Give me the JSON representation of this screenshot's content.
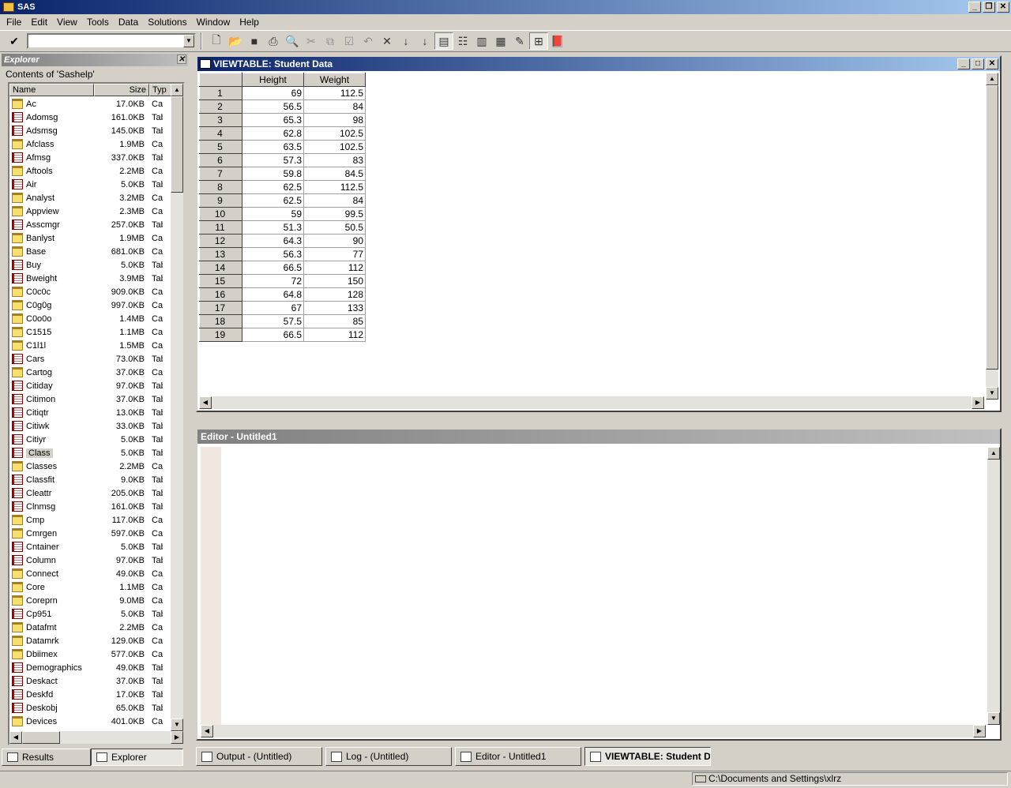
{
  "app": {
    "title": "SAS"
  },
  "menu": [
    "File",
    "Edit",
    "View",
    "Tools",
    "Data",
    "Solutions",
    "Window",
    "Help"
  ],
  "command_box": {
    "value": ""
  },
  "explorer": {
    "title": "Explorer",
    "contents_label": "Contents of 'Sashelp'",
    "columns": [
      "Name",
      "Size",
      "Typ"
    ],
    "items": [
      {
        "name": "Ac",
        "size": "17.0KB",
        "type": "Cata",
        "icon": "folder"
      },
      {
        "name": "Adomsg",
        "size": "161.0KB",
        "type": "Tabl",
        "icon": "table"
      },
      {
        "name": "Adsmsg",
        "size": "145.0KB",
        "type": "Tabl",
        "icon": "table"
      },
      {
        "name": "Afclass",
        "size": "1.9MB",
        "type": "Cata",
        "icon": "folder"
      },
      {
        "name": "Afmsg",
        "size": "337.0KB",
        "type": "Tabl",
        "icon": "table"
      },
      {
        "name": "Aftools",
        "size": "2.2MB",
        "type": "Cata",
        "icon": "folder"
      },
      {
        "name": "Air",
        "size": "5.0KB",
        "type": "Tabl",
        "icon": "table"
      },
      {
        "name": "Analyst",
        "size": "3.2MB",
        "type": "Cata",
        "icon": "folder"
      },
      {
        "name": "Appview",
        "size": "2.3MB",
        "type": "Cata",
        "icon": "folder"
      },
      {
        "name": "Asscmgr",
        "size": "257.0KB",
        "type": "Tabl",
        "icon": "table"
      },
      {
        "name": "Banlyst",
        "size": "1.9MB",
        "type": "Cata",
        "icon": "folder"
      },
      {
        "name": "Base",
        "size": "681.0KB",
        "type": "Cata",
        "icon": "folder"
      },
      {
        "name": "Buy",
        "size": "5.0KB",
        "type": "Tabl",
        "icon": "table"
      },
      {
        "name": "Bweight",
        "size": "3.9MB",
        "type": "Tabl",
        "icon": "table"
      },
      {
        "name": "C0c0c",
        "size": "909.0KB",
        "type": "Cata",
        "icon": "folder"
      },
      {
        "name": "C0g0g",
        "size": "997.0KB",
        "type": "Cata",
        "icon": "folder"
      },
      {
        "name": "C0o0o",
        "size": "1.4MB",
        "type": "Cata",
        "icon": "folder"
      },
      {
        "name": "C1515",
        "size": "1.1MB",
        "type": "Cata",
        "icon": "folder"
      },
      {
        "name": "C1l1l",
        "size": "1.5MB",
        "type": "Cata",
        "icon": "folder"
      },
      {
        "name": "Cars",
        "size": "73.0KB",
        "type": "Tabl",
        "icon": "table"
      },
      {
        "name": "Cartog",
        "size": "37.0KB",
        "type": "Cata",
        "icon": "folder"
      },
      {
        "name": "Citiday",
        "size": "97.0KB",
        "type": "Tabl",
        "icon": "table"
      },
      {
        "name": "Citimon",
        "size": "37.0KB",
        "type": "Tabl",
        "icon": "table"
      },
      {
        "name": "Citiqtr",
        "size": "13.0KB",
        "type": "Tabl",
        "icon": "table"
      },
      {
        "name": "Citiwk",
        "size": "33.0KB",
        "type": "Tabl",
        "icon": "table"
      },
      {
        "name": "Citiyr",
        "size": "5.0KB",
        "type": "Tabl",
        "icon": "table"
      },
      {
        "name": "Class",
        "size": "5.0KB",
        "type": "Tabl",
        "icon": "table",
        "selected": true
      },
      {
        "name": "Classes",
        "size": "2.2MB",
        "type": "Cata",
        "icon": "folder"
      },
      {
        "name": "Classfit",
        "size": "9.0KB",
        "type": "Tabl",
        "icon": "table"
      },
      {
        "name": "Cleattr",
        "size": "205.0KB",
        "type": "Tabl",
        "icon": "table"
      },
      {
        "name": "Clnmsg",
        "size": "161.0KB",
        "type": "Tabl",
        "icon": "table"
      },
      {
        "name": "Cmp",
        "size": "117.0KB",
        "type": "Cata",
        "icon": "folder"
      },
      {
        "name": "Cmrgen",
        "size": "597.0KB",
        "type": "Cata",
        "icon": "folder"
      },
      {
        "name": "Cntainer",
        "size": "5.0KB",
        "type": "Tabl",
        "icon": "table"
      },
      {
        "name": "Column",
        "size": "97.0KB",
        "type": "Tabl",
        "icon": "table"
      },
      {
        "name": "Connect",
        "size": "49.0KB",
        "type": "Cata",
        "icon": "folder"
      },
      {
        "name": "Core",
        "size": "1.1MB",
        "type": "Cata",
        "icon": "folder"
      },
      {
        "name": "Coreprn",
        "size": "9.0MB",
        "type": "Cata",
        "icon": "folder"
      },
      {
        "name": "Cp951",
        "size": "5.0KB",
        "type": "Tabl",
        "icon": "table"
      },
      {
        "name": "Datafmt",
        "size": "2.2MB",
        "type": "Cata",
        "icon": "folder"
      },
      {
        "name": "Datamrk",
        "size": "129.0KB",
        "type": "Cata",
        "icon": "folder"
      },
      {
        "name": "Dbiimex",
        "size": "577.0KB",
        "type": "Cata",
        "icon": "folder"
      },
      {
        "name": "Demographics",
        "size": "49.0KB",
        "type": "Tabl",
        "icon": "table"
      },
      {
        "name": "Deskact",
        "size": "37.0KB",
        "type": "Tabl",
        "icon": "table"
      },
      {
        "name": "Deskfd",
        "size": "17.0KB",
        "type": "Tabl",
        "icon": "table"
      },
      {
        "name": "Deskobj",
        "size": "65.0KB",
        "type": "Tabl",
        "icon": "table"
      },
      {
        "name": "Devices",
        "size": "401.0KB",
        "type": "Cata",
        "icon": "folder"
      }
    ],
    "tabs": [
      "Results",
      "Explorer"
    ]
  },
  "viewtable": {
    "title": "VIEWTABLE: Student Data",
    "columns": [
      "Height",
      "Weight"
    ],
    "rows": [
      [
        "1",
        "69",
        "112.5"
      ],
      [
        "2",
        "56.5",
        "84"
      ],
      [
        "3",
        "65.3",
        "98"
      ],
      [
        "4",
        "62.8",
        "102.5"
      ],
      [
        "5",
        "63.5",
        "102.5"
      ],
      [
        "6",
        "57.3",
        "83"
      ],
      [
        "7",
        "59.8",
        "84.5"
      ],
      [
        "8",
        "62.5",
        "112.5"
      ],
      [
        "9",
        "62.5",
        "84"
      ],
      [
        "10",
        "59",
        "99.5"
      ],
      [
        "11",
        "51.3",
        "50.5"
      ],
      [
        "12",
        "64.3",
        "90"
      ],
      [
        "13",
        "56.3",
        "77"
      ],
      [
        "14",
        "66.5",
        "112"
      ],
      [
        "15",
        "72",
        "150"
      ],
      [
        "16",
        "64.8",
        "128"
      ],
      [
        "17",
        "67",
        "133"
      ],
      [
        "18",
        "57.5",
        "85"
      ],
      [
        "19",
        "66.5",
        "112"
      ]
    ]
  },
  "editor": {
    "title": "Editor - Untitled1"
  },
  "window_tabs": [
    {
      "label": "Output - (Untitled)",
      "active": false
    },
    {
      "label": "Log - (Untitled)",
      "active": false
    },
    {
      "label": "Editor - Untitled1",
      "active": false
    },
    {
      "label": "VIEWTABLE: Student D...",
      "active": true
    }
  ],
  "status": {
    "path": "C:\\Documents and Settings\\xlrz"
  }
}
